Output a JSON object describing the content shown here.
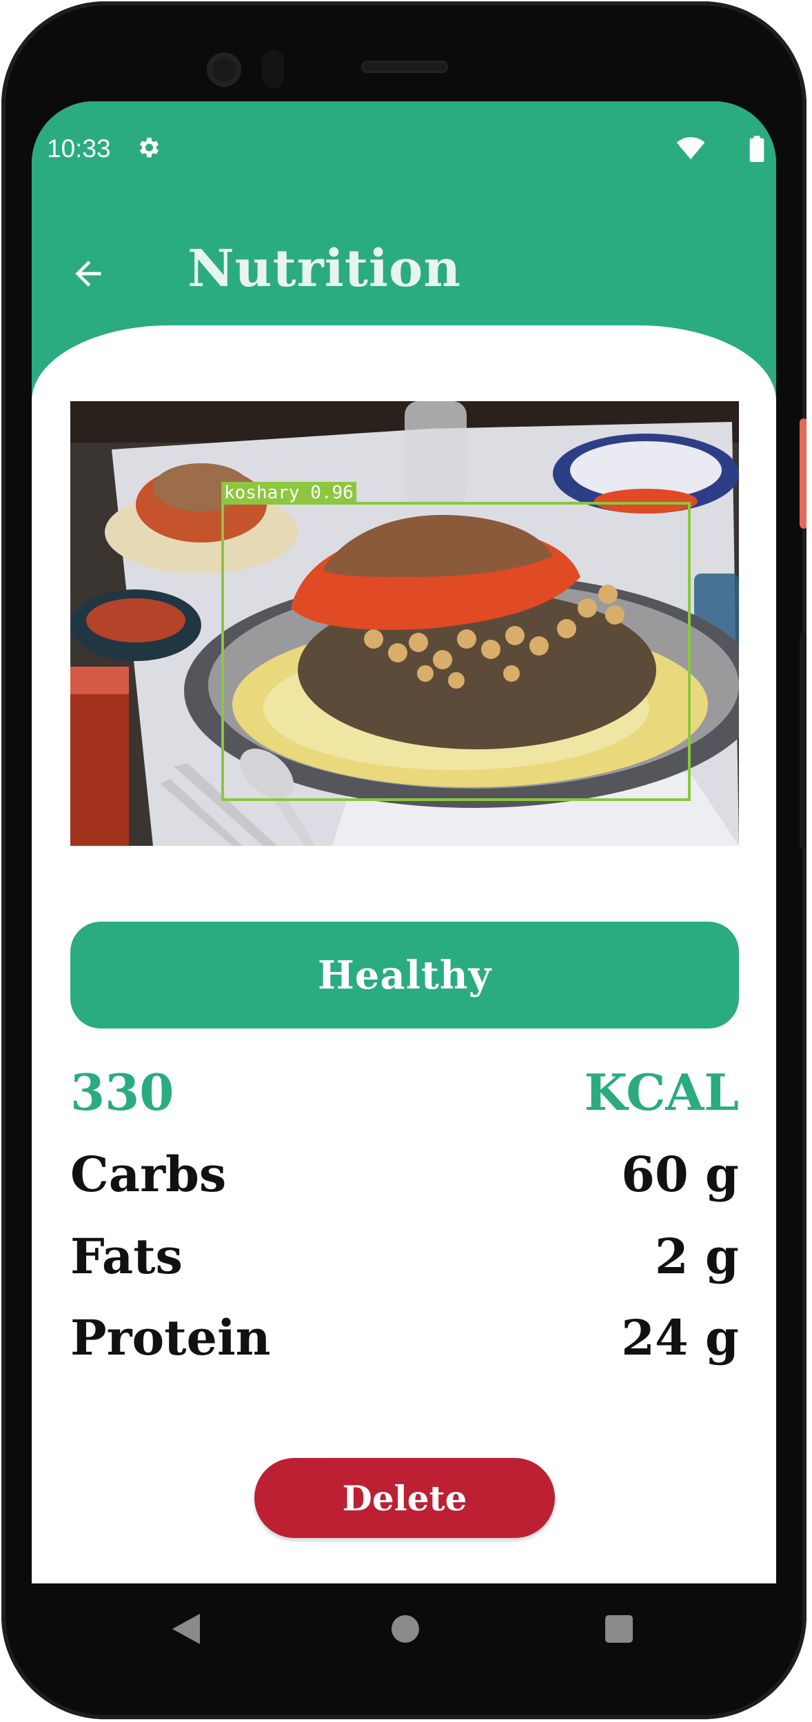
{
  "status_bar": {
    "time": "10:33",
    "icons": [
      "gear-icon",
      "wifi-icon",
      "battery-icon"
    ]
  },
  "header": {
    "title": "Nutrition",
    "back_icon": "arrow-left-icon"
  },
  "detection": {
    "label": "koshary 0.96",
    "box_color": "#8dc63f"
  },
  "health_status": "Healthy",
  "calories": {
    "value": "330",
    "unit": "KCAL"
  },
  "nutrients": [
    {
      "name": "Carbs",
      "amount": "60 g"
    },
    {
      "name": "Fats",
      "amount": "2 g"
    },
    {
      "name": "Protein",
      "amount": "24 g"
    }
  ],
  "actions": {
    "delete_label": "Delete"
  },
  "colors": {
    "primary": "#2aab80",
    "danger": "#bd2033",
    "text": "#111111"
  },
  "nav_bar": {
    "icons": [
      "back-triangle-icon",
      "home-circle-icon",
      "recents-square-icon"
    ]
  }
}
